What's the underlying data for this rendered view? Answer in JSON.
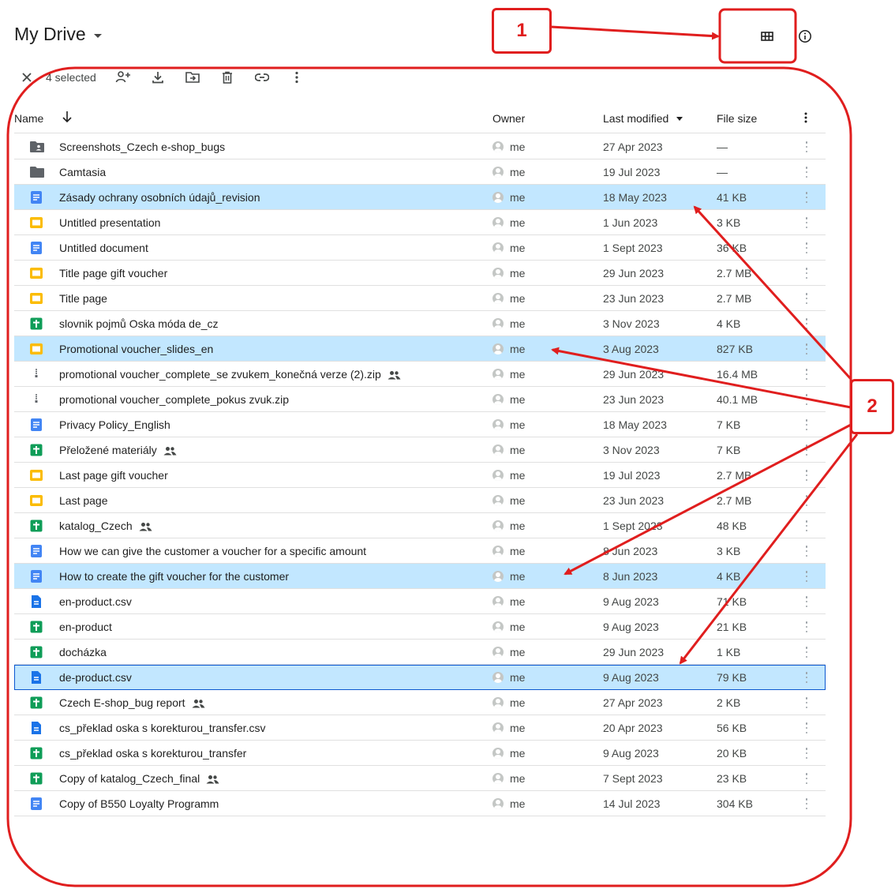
{
  "header": {
    "title": "My Drive",
    "view_toggle_icon": "grid-view-icon",
    "info_icon": "info-icon"
  },
  "toolbar": {
    "selected_text": "4 selected",
    "actions": [
      "close-icon",
      "share-icon",
      "download-icon",
      "move-icon",
      "trash-icon",
      "link-icon",
      "more-vert-icon"
    ]
  },
  "columns": {
    "name": "Name",
    "owner": "Owner",
    "last_modified": "Last modified",
    "file_size": "File size"
  },
  "files": [
    {
      "name": "Screenshots_Czech e-shop_bugs",
      "type": "shared-folder",
      "owner": "me",
      "modified": "27 Apr 2023",
      "size": "—",
      "shared": false,
      "selected": false
    },
    {
      "name": "Camtasia",
      "type": "folder",
      "owner": "me",
      "modified": "19 Jul 2023",
      "size": "—",
      "shared": false,
      "selected": false
    },
    {
      "name": "Zásady ochrany osobních údajů_revision",
      "type": "doc",
      "owner": "me",
      "modified": "18 May 2023",
      "size": "41 KB",
      "shared": false,
      "selected": true
    },
    {
      "name": "Untitled presentation",
      "type": "slides",
      "owner": "me",
      "modified": "1 Jun 2023",
      "size": "3 KB",
      "shared": false,
      "selected": false
    },
    {
      "name": "Untitled document",
      "type": "doc",
      "owner": "me",
      "modified": "1 Sept 2023",
      "size": "36 KB",
      "shared": false,
      "selected": false
    },
    {
      "name": "Title page gift voucher",
      "type": "slides",
      "owner": "me",
      "modified": "29 Jun 2023",
      "size": "2.7 MB",
      "shared": false,
      "selected": false
    },
    {
      "name": "Title page",
      "type": "slides",
      "owner": "me",
      "modified": "23 Jun 2023",
      "size": "2.7 MB",
      "shared": false,
      "selected": false
    },
    {
      "name": "slovnik pojmů Oska móda de_cz",
      "type": "sheets",
      "owner": "me",
      "modified": "3 Nov 2023",
      "size": "4 KB",
      "shared": false,
      "selected": false
    },
    {
      "name": "Promotional voucher_slides_en",
      "type": "slides",
      "owner": "me",
      "modified": "3 Aug 2023",
      "size": "827 KB",
      "shared": false,
      "selected": true
    },
    {
      "name": "promotional voucher_complete_se zvukem_konečná verze (2).zip",
      "type": "zip",
      "owner": "me",
      "modified": "29 Jun 2023",
      "size": "16.4 MB",
      "shared": true,
      "selected": false
    },
    {
      "name": "promotional voucher_complete_pokus zvuk.zip",
      "type": "zip",
      "owner": "me",
      "modified": "23 Jun 2023",
      "size": "40.1 MB",
      "shared": false,
      "selected": false
    },
    {
      "name": "Privacy Policy_English",
      "type": "doc",
      "owner": "me",
      "modified": "18 May 2023",
      "size": "7 KB",
      "shared": false,
      "selected": false
    },
    {
      "name": "Přeložené materiály",
      "type": "sheets",
      "owner": "me",
      "modified": "3 Nov 2023",
      "size": "7 KB",
      "shared": true,
      "selected": false
    },
    {
      "name": "Last page gift voucher",
      "type": "slides",
      "owner": "me",
      "modified": "19 Jul 2023",
      "size": "2.7 MB",
      "shared": false,
      "selected": false
    },
    {
      "name": "Last page",
      "type": "slides",
      "owner": "me",
      "modified": "23 Jun 2023",
      "size": "2.7 MB",
      "shared": false,
      "selected": false
    },
    {
      "name": "katalog_Czech",
      "type": "sheets",
      "owner": "me",
      "modified": "1 Sept 2023",
      "size": "48 KB",
      "shared": true,
      "selected": false
    },
    {
      "name": "How we can give the customer a voucher for a specific amount",
      "type": "doc",
      "owner": "me",
      "modified": "8 Jun 2023",
      "size": "3 KB",
      "shared": false,
      "selected": false
    },
    {
      "name": "How to create the gift voucher for the customer",
      "type": "doc",
      "owner": "me",
      "modified": "8 Jun 2023",
      "size": "4 KB",
      "shared": false,
      "selected": true
    },
    {
      "name": "en-product.csv",
      "type": "csv",
      "owner": "me",
      "modified": "9 Aug 2023",
      "size": "71 KB",
      "shared": false,
      "selected": false
    },
    {
      "name": "en-product",
      "type": "sheets",
      "owner": "me",
      "modified": "9 Aug 2023",
      "size": "21 KB",
      "shared": false,
      "selected": false
    },
    {
      "name": "docházka",
      "type": "sheets",
      "owner": "me",
      "modified": "29 Jun 2023",
      "size": "1 KB",
      "shared": false,
      "selected": false
    },
    {
      "name": "de-product.csv",
      "type": "csv",
      "owner": "me",
      "modified": "9 Aug 2023",
      "size": "79 KB",
      "shared": false,
      "selected": true,
      "focused": true
    },
    {
      "name": "Czech E-shop_bug report",
      "type": "sheets",
      "owner": "me",
      "modified": "27 Apr 2023",
      "size": "2 KB",
      "shared": true,
      "selected": false
    },
    {
      "name": "cs_překlad oska s korekturou_transfer.csv",
      "type": "csv",
      "owner": "me",
      "modified": "20 Apr 2023",
      "size": "56 KB",
      "shared": false,
      "selected": false
    },
    {
      "name": "cs_překlad oska s korekturou_transfer",
      "type": "sheets",
      "owner": "me",
      "modified": "9 Aug 2023",
      "size": "20 KB",
      "shared": false,
      "selected": false
    },
    {
      "name": "Copy of katalog_Czech_final",
      "type": "sheets",
      "owner": "me",
      "modified": "7 Sept 2023",
      "size": "23 KB",
      "shared": true,
      "selected": false
    },
    {
      "name": "Copy of B550 Loyalty Programm",
      "type": "doc",
      "owner": "me",
      "modified": "14 Jul 2023",
      "size": "304 KB",
      "shared": false,
      "selected": false
    }
  ],
  "annotations": {
    "callout_1": "1",
    "callout_2": "2",
    "color": "#e01e1e"
  },
  "colors": {
    "selected_row": "#c2e7ff",
    "doc": "#4285f4",
    "slides": "#fbbc04",
    "sheets": "#0f9d58",
    "folder": "#5f6368"
  }
}
